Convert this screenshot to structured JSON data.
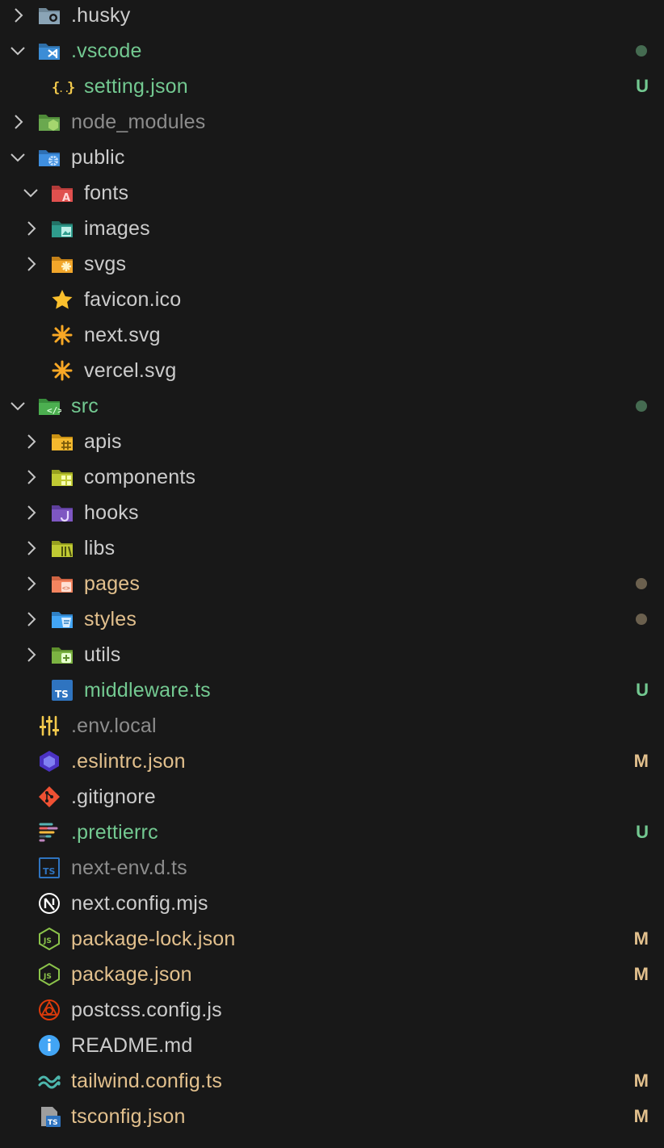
{
  "explorer": {
    "items": [
      {
        "label": ".husky",
        "depth": 0,
        "chevron": "closed",
        "icon": "husky-folder-icon",
        "color": "default"
      },
      {
        "label": ".vscode",
        "depth": 0,
        "chevron": "open",
        "icon": "vscode-folder-icon",
        "color": "green",
        "status_dot": "green"
      },
      {
        "label": "setting.json",
        "depth": 1,
        "chevron": "none",
        "icon": "json-braces-icon",
        "color": "green",
        "status": "U"
      },
      {
        "label": "node_modules",
        "depth": 0,
        "chevron": "closed",
        "icon": "node-folder-icon",
        "color": "dim"
      },
      {
        "label": "public",
        "depth": 0,
        "chevron": "open",
        "icon": "public-folder-icon",
        "color": "default"
      },
      {
        "label": "fonts",
        "depth": 1,
        "chevron": "open",
        "icon": "fonts-folder-icon",
        "color": "default"
      },
      {
        "label": "images",
        "depth": 1,
        "chevron": "closed",
        "icon": "images-folder-icon",
        "color": "default"
      },
      {
        "label": "svgs",
        "depth": 1,
        "chevron": "closed",
        "icon": "svg-folder-icon",
        "color": "default"
      },
      {
        "label": "favicon.ico",
        "depth": 1,
        "chevron": "none",
        "icon": "star-icon",
        "color": "default"
      },
      {
        "label": "next.svg",
        "depth": 1,
        "chevron": "none",
        "icon": "asterisk-icon",
        "color": "default"
      },
      {
        "label": "vercel.svg",
        "depth": 1,
        "chevron": "none",
        "icon": "asterisk-icon",
        "color": "default"
      },
      {
        "label": "src",
        "depth": 0,
        "chevron": "open",
        "icon": "src-folder-icon",
        "color": "green",
        "status_dot": "green"
      },
      {
        "label": "apis",
        "depth": 1,
        "chevron": "closed",
        "icon": "api-folder-icon",
        "color": "default"
      },
      {
        "label": "components",
        "depth": 1,
        "chevron": "closed",
        "icon": "components-folder-icon",
        "color": "default"
      },
      {
        "label": "hooks",
        "depth": 1,
        "chevron": "closed",
        "icon": "hooks-folder-icon",
        "color": "default"
      },
      {
        "label": "libs",
        "depth": 1,
        "chevron": "closed",
        "icon": "lib-folder-icon",
        "color": "default"
      },
      {
        "label": "pages",
        "depth": 1,
        "chevron": "closed",
        "icon": "pages-folder-icon",
        "color": "mod",
        "status_dot": "mod"
      },
      {
        "label": "styles",
        "depth": 1,
        "chevron": "closed",
        "icon": "styles-folder-icon",
        "color": "mod",
        "status_dot": "mod"
      },
      {
        "label": "utils",
        "depth": 1,
        "chevron": "closed",
        "icon": "utils-folder-icon",
        "color": "default"
      },
      {
        "label": "middleware.ts",
        "depth": 1,
        "chevron": "none",
        "icon": "typescript-icon",
        "color": "green",
        "status": "U"
      },
      {
        "label": ".env.local",
        "depth": 0,
        "chevron": "none",
        "icon": "sliders-icon",
        "color": "dim"
      },
      {
        "label": ".eslintrc.json",
        "depth": 0,
        "chevron": "none",
        "icon": "eslint-icon",
        "color": "mod",
        "status": "M"
      },
      {
        "label": ".gitignore",
        "depth": 0,
        "chevron": "none",
        "icon": "git-icon",
        "color": "default"
      },
      {
        "label": ".prettierrc",
        "depth": 0,
        "chevron": "none",
        "icon": "prettier-icon",
        "color": "green",
        "status": "U"
      },
      {
        "label": "next-env.d.ts",
        "depth": 0,
        "chevron": "none",
        "icon": "typescript-def-icon",
        "color": "dim"
      },
      {
        "label": "next.config.mjs",
        "depth": 0,
        "chevron": "none",
        "icon": "nextjs-icon",
        "color": "default"
      },
      {
        "label": "package-lock.json",
        "depth": 0,
        "chevron": "none",
        "icon": "nodejs-icon",
        "color": "mod",
        "status": "M"
      },
      {
        "label": "package.json",
        "depth": 0,
        "chevron": "none",
        "icon": "nodejs-icon",
        "color": "mod",
        "status": "M"
      },
      {
        "label": "postcss.config.js",
        "depth": 0,
        "chevron": "none",
        "icon": "postcss-icon",
        "color": "default"
      },
      {
        "label": "README.md",
        "depth": 0,
        "chevron": "none",
        "icon": "info-icon",
        "color": "default"
      },
      {
        "label": "tailwind.config.ts",
        "depth": 0,
        "chevron": "none",
        "icon": "tailwind-icon",
        "color": "mod",
        "status": "M"
      },
      {
        "label": "tsconfig.json",
        "depth": 0,
        "chevron": "none",
        "icon": "tsconfig-icon",
        "color": "mod",
        "status": "M"
      }
    ]
  },
  "colors": {
    "background": "#181818",
    "untracked": "#73c991",
    "modified": "#e2c08d",
    "default_text": "#cccccc",
    "ignored_text": "#8c8c8c"
  }
}
